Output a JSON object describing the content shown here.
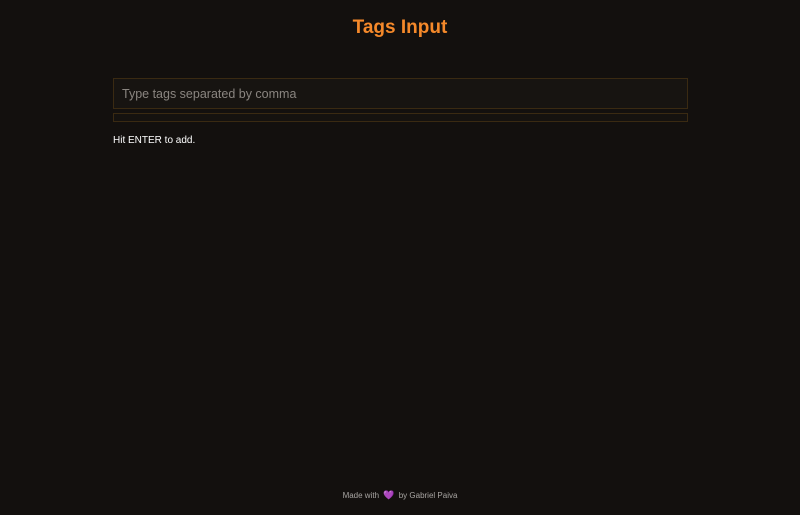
{
  "header": {
    "title": "Tags Input"
  },
  "tags_input": {
    "placeholder": "Type tags separated by comma",
    "value": ""
  },
  "tags_list": {
    "items": []
  },
  "hint": {
    "text": "Hit ENTER to add."
  },
  "footer": {
    "prefix": "Made with",
    "icon": "heart-icon",
    "icon_glyph": "💜",
    "suffix": "by Gabriel Paiva"
  },
  "colors": {
    "accent": "#f5892a",
    "background": "#13100e",
    "heart": "#8e3fd1"
  }
}
